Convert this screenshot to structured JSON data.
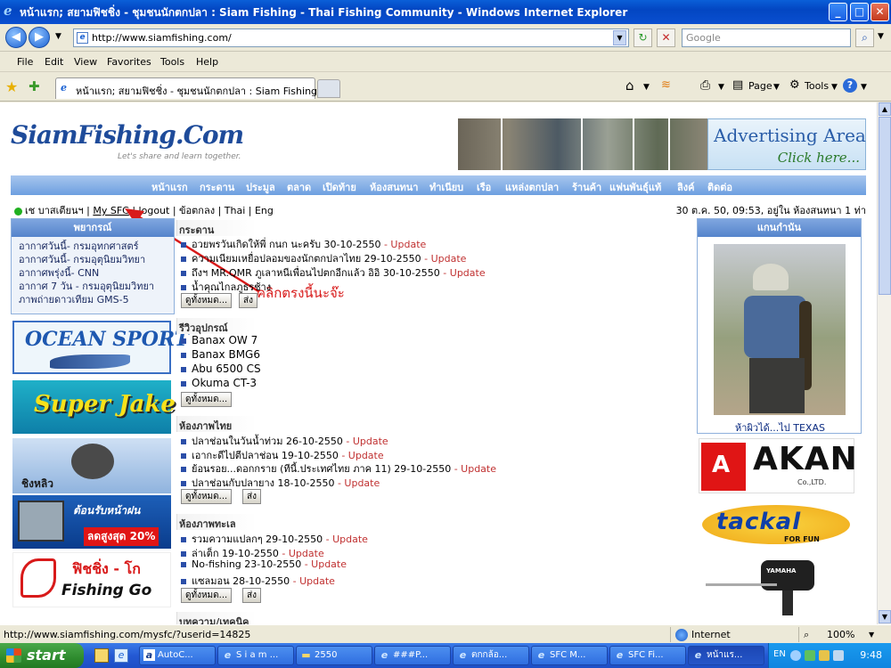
{
  "window": {
    "title": "หน้าแรก; สยามฟิชชิ่ง - ชุมชนนักตกปลา : Siam Fishing - Thai Fishing Community - Windows Internet Explorer",
    "min": "_",
    "max": "□",
    "close": "✕"
  },
  "address": {
    "url": "http://www.siamfishing.com/",
    "search_placeholder": "Google"
  },
  "menu": [
    "File",
    "Edit",
    "View",
    "Favorites",
    "Tools",
    "Help"
  ],
  "tab": {
    "title": "หน้าแรก; สยามฟิชชิ่ง - ชุมชนนักตกปลา : Siam Fishing - ...",
    "page": "Page",
    "tools": "Tools"
  },
  "site": {
    "logo": "SiamFishing.Com",
    "tagline": "Let's share and learn together.",
    "ad_line1": "Advertising Area",
    "ad_line2": "Click here...",
    "nav": [
      "หน้าแรก",
      "กระดาน",
      "ประมูล",
      "ตลาด",
      "เปิดท้าย",
      "ห้องสนทนา",
      "ทำเนียบ",
      "เรือ",
      "แหล่งตกปลา",
      "ร้านค้า",
      "แฟนพันธุ์แท้",
      "ลิงค์",
      "ติดต่อ"
    ],
    "login": {
      "user": "เช บาสเตียนฯ |",
      "mysfc": "My SFC",
      "rest": "| logout | ข้อตกลง | Thai | Eng"
    },
    "datetime": "30 ต.ค. 50, 09:53, อยู่ใน ห้องสนทนา 1 ท่า"
  },
  "weather": {
    "title": "พยากรณ์",
    "lines": [
      "อากาศวันนี้- กรมอุทกศาสตร์",
      "อากาศวันนี้- กรมอุตุนิยมวิทยา",
      "อากาศพรุ่งนี้- CNN",
      "อากาศ 7 วัน - กรมอุตุนิยมวิทยา",
      "ภาพถ่ายดาวเทียม GMS-5"
    ]
  },
  "left_banners": {
    "ocean": "OCEAN SPORT",
    "superjake": "Super Jake",
    "ching": "ชิงหลิว",
    "promo1": "ต้อนรับหน้าฝน",
    "promo2": "ลดสูงสุด 20%",
    "fishinggo1": "ฟิชชิ่ง - โก",
    "fishinggo2": "Fishing Go"
  },
  "board": {
    "title": "กระดาน",
    "items": [
      {
        "text": "อวยพรวันเกิดให้พี่ กนก นะครับ 30-10-2550",
        "upd": "- Update"
      },
      {
        "text": "ความเนียมเหยื่อปลอมของนักตกปลาไทย 29-10-2550",
        "upd": "- Update"
      },
      {
        "text": "ถึงฯ MR.QMR ภูเลาหนีเพื่อนไปตกอีกแล้ว อิอิ 30-10-2550",
        "upd": "- Update"
      },
      {
        "text": "น้ำคุณไกลภูธรช้าง",
        "upd": ""
      }
    ],
    "see_all": "ดูทั้งหมด...",
    "post": "ส่ง"
  },
  "annotation": "คลิกตรงนี้นะจ๊ะ",
  "review": {
    "title": "รีวิวอุปกรณ์",
    "items": [
      "Banax OW 7",
      "Banax BMG6",
      "Abu 6500 CS",
      "Okuma CT-3"
    ],
    "see_all": "ดูทั้งหมด..."
  },
  "thai_room": {
    "title": "ห้องภาพไทย",
    "items": [
      {
        "text": "ปลาช่อนในวันน้ำท่วม 26-10-2550",
        "upd": "- Update"
      },
      {
        "text": "เอากะดีไปตีปลาช่อน 19-10-2550",
        "upd": "- Update"
      },
      {
        "text": "ย้อนรอย...ดอกกราย (ทีนี้.ประเทศไทย ภาค 11) 29-10-2550",
        "upd": "- Update"
      },
      {
        "text": "ปลาช่อนกับปลายาง 18-10-2550",
        "upd": "- Update"
      }
    ],
    "see_all": "ดูทั้งหมด...",
    "post": "ส่ง"
  },
  "sea_room": {
    "title": "ห้องภาพทะเล",
    "items": [
      {
        "text": "รวมความแปลกๆ 29-10-2550",
        "upd": "- Update"
      },
      {
        "text": "ล่าเต็ก 19-10-2550",
        "upd": "- Update"
      },
      {
        "text": "No-fishing 23-10-2550",
        "upd": "- Update"
      },
      {
        "text": "แซลมอน 28-10-2550",
        "upd": "- Update"
      }
    ],
    "see_all": "ดูทั้งหมด...",
    "post": "ส่ง"
  },
  "next_section": "บทความ/เทคนิค",
  "featured": {
    "title": "แกนกำนัน",
    "caption": "ห้าผิวได้...ไป TEXAS"
  },
  "right_banners": {
    "akan": "AKAN",
    "akan_sub": "Co.,LTD.",
    "tackle": "tackal",
    "tackle_sub": "FOR FUN",
    "yamaha": "YAMAHA"
  },
  "status": {
    "url": "http://www.siamfishing.com/mysfc/?userid=14825",
    "zone": "Internet",
    "zoom": "100%"
  },
  "taskbar": {
    "start": "start",
    "items": [
      "AutoC...",
      "S i a m ...",
      "2550",
      "###P...",
      "ตกกล้อ...",
      "SFC M...",
      "SFC Fi...",
      "หน้าแร..."
    ],
    "lang": "EN",
    "clock": "9:48"
  },
  "colors": {
    "titlebar": "#0346c2",
    "sitenav": "#6d9fe0",
    "update_red": "#c03030",
    "annotation_red": "#d81a1a"
  }
}
